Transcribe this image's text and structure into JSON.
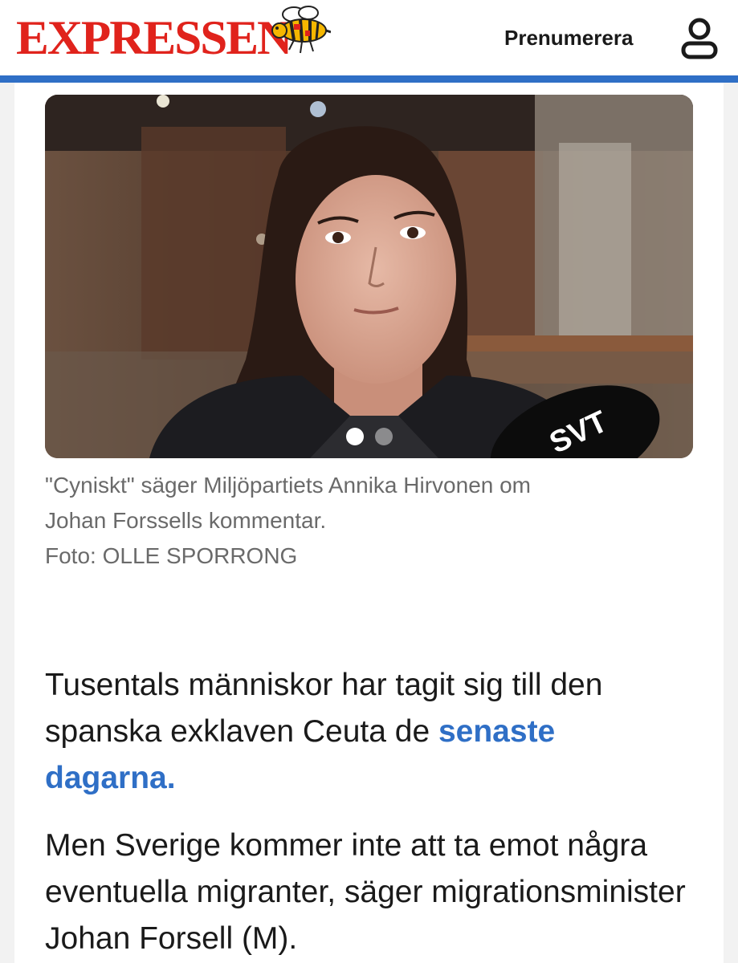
{
  "header": {
    "logo_text": "EXPRESSEN",
    "subscribe_label": "Prenumerera",
    "user_icon": "user-icon",
    "logo_icon": "wasp-icon",
    "accent_color": "#2f6fc6",
    "brand_color": "#e0231c"
  },
  "hero": {
    "image_subject": "Woman with dark hair speaking to press, SVT microphone in foreground",
    "mic_label": "SVT",
    "slide_count": 2,
    "active_slide": 1
  },
  "caption": {
    "line1": "\"Cyniskt\" säger Miljöpartiets Annika Hirvonen om",
    "line2": "Johan Forssells kommentar.",
    "credit": "Foto: OLLE SPORRONG"
  },
  "article": {
    "lead_text": "Tusentals människor har tagit sig till den spanska exklaven Ceuta de ",
    "lead_link": "senaste dagarna.",
    "paragraph2": "Men Sverige kommer inte att ta emot några eventuella migranter, säger migrationsminister Johan Forsell (M)."
  }
}
